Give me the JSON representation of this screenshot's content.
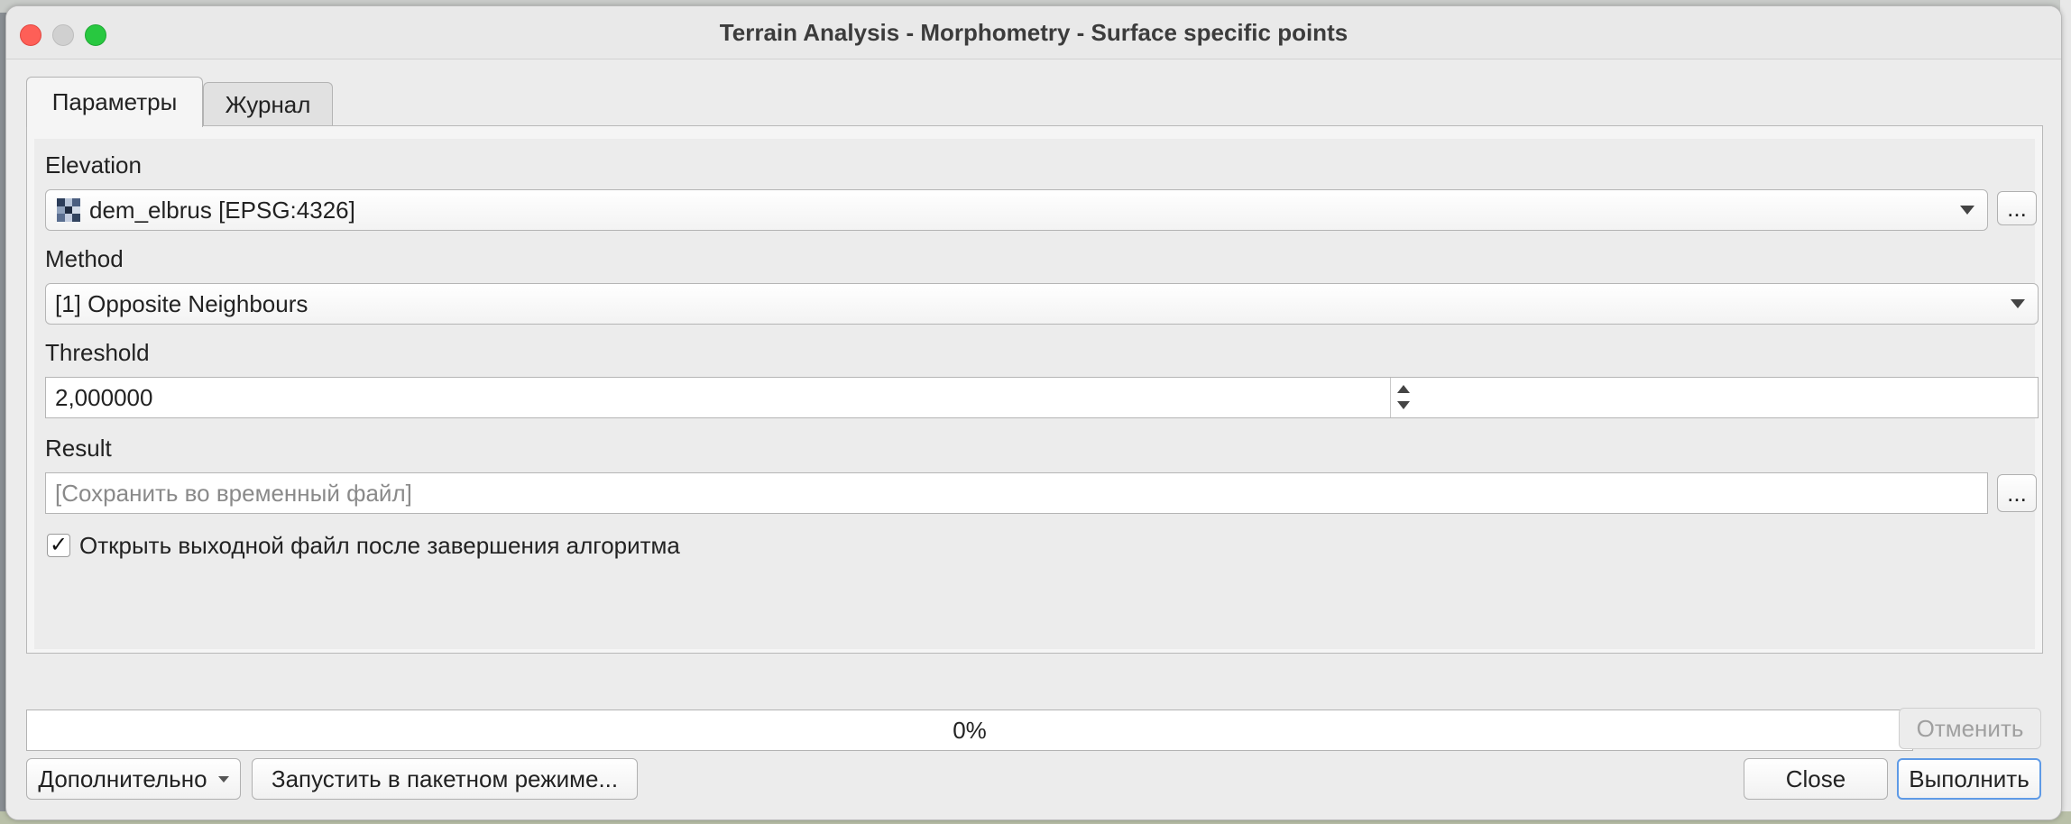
{
  "window": {
    "title": "Terrain Analysis - Morphometry - Surface specific points"
  },
  "tabs": [
    {
      "label": "Параметры",
      "active": true
    },
    {
      "label": "Журнал",
      "active": false
    }
  ],
  "params": {
    "elevation": {
      "label": "Elevation",
      "value": "dem_elbrus [EPSG:4326]",
      "browse_label": "..."
    },
    "method": {
      "label": "Method",
      "value": "[1] Opposite Neighbours"
    },
    "threshold": {
      "label": "Threshold",
      "value": "2,000000"
    },
    "result": {
      "label": "Result",
      "placeholder": "[Сохранить во временный файл]",
      "browse_label": "..."
    },
    "open_output": {
      "label": "Открыть выходной файл после завершения алгоритма",
      "checked": true,
      "check_glyph": "✓"
    }
  },
  "progress": {
    "text": "0%",
    "value": 0
  },
  "buttons": {
    "cancel": "Отменить",
    "advanced": "Дополнительно",
    "batch": "Запустить в пакетном режиме...",
    "close": "Close",
    "run": "Выполнить"
  },
  "colors": {
    "accent": "#5e9ae6",
    "close_dot": "#fe5f57",
    "max_dot": "#28c840"
  }
}
